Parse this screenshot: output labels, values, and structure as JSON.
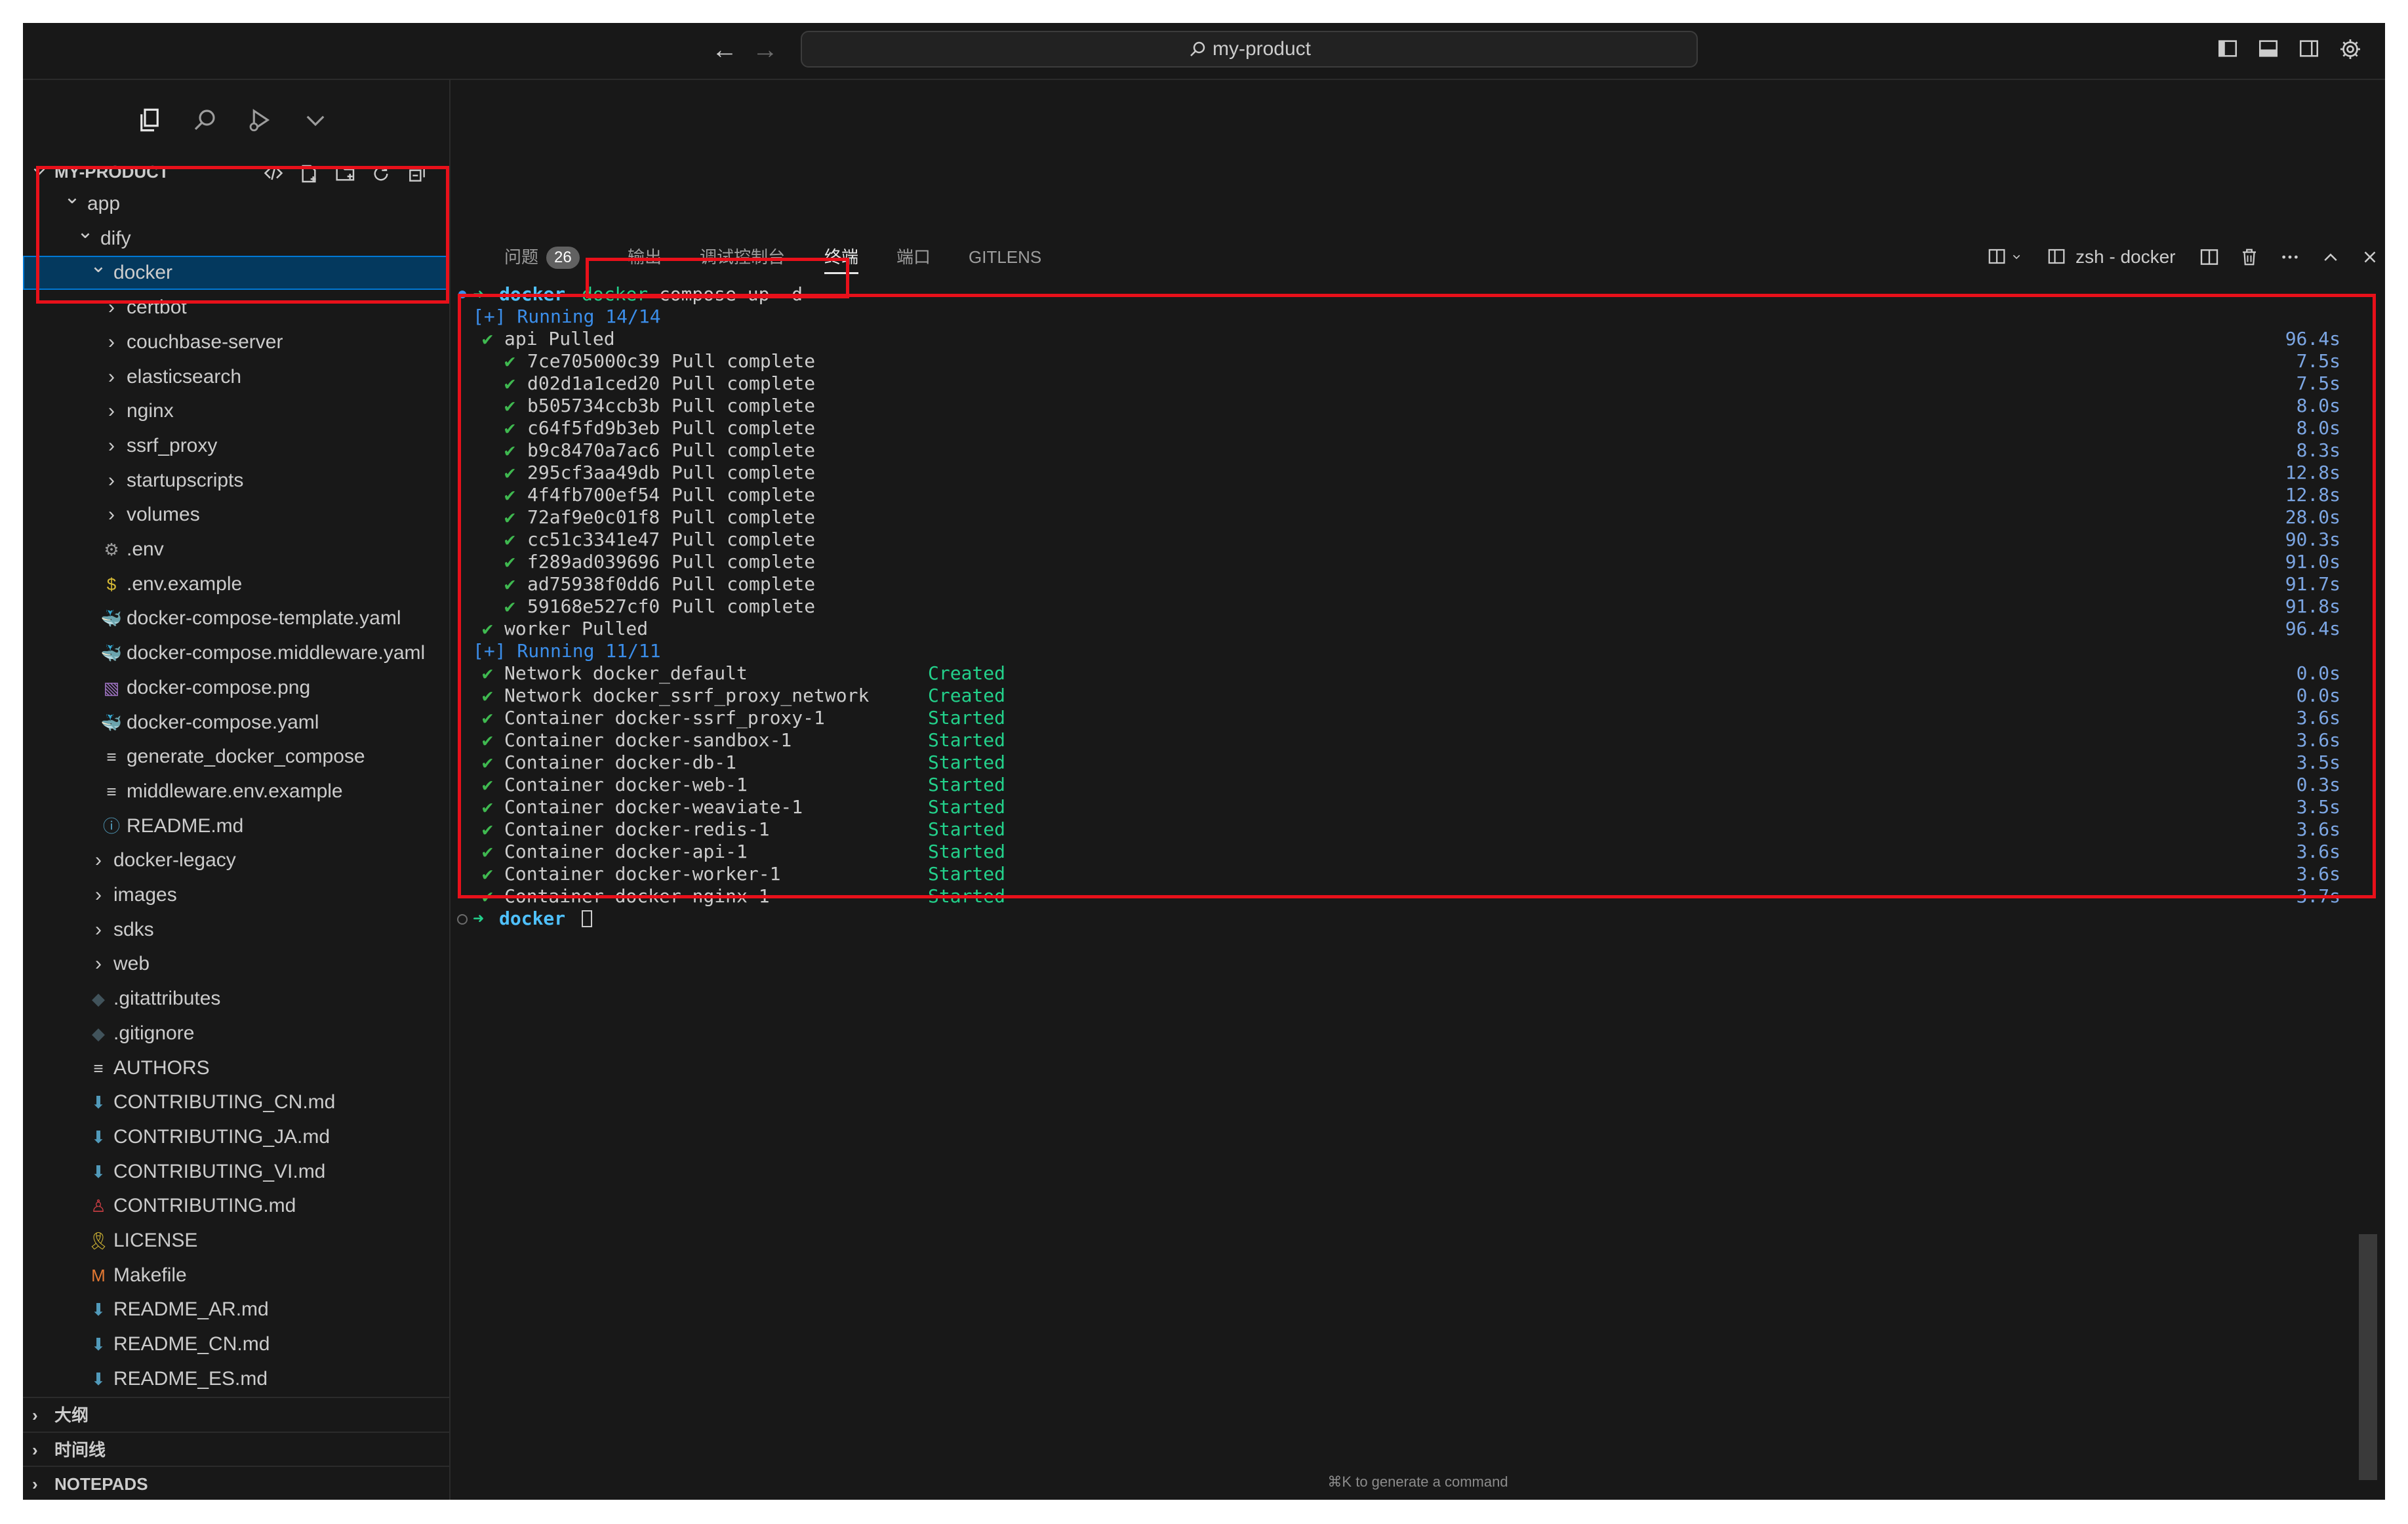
{
  "titlebar": {
    "search_text": "my-product",
    "nav_back": "←",
    "nav_forward": "→"
  },
  "sidebar": {
    "section_title": "MY-PRODUCT",
    "tree": [
      {
        "label": "app",
        "level": 0,
        "type": "folder",
        "open": true
      },
      {
        "label": "dify",
        "level": 1,
        "type": "folder",
        "open": true
      },
      {
        "label": "docker",
        "level": 2,
        "type": "folder",
        "open": true,
        "selected": true
      },
      {
        "label": "certbot",
        "level": 3,
        "type": "folder"
      },
      {
        "label": "couchbase-server",
        "level": 3,
        "type": "folder"
      },
      {
        "label": "elasticsearch",
        "level": 3,
        "type": "folder"
      },
      {
        "label": "nginx",
        "level": 3,
        "type": "folder"
      },
      {
        "label": "ssrf_proxy",
        "level": 3,
        "type": "folder"
      },
      {
        "label": "startupscripts",
        "level": 3,
        "type": "folder"
      },
      {
        "label": "volumes",
        "level": 3,
        "type": "folder"
      },
      {
        "label": ".env",
        "level": 3,
        "type": "gear"
      },
      {
        "label": ".env.example",
        "level": 3,
        "type": "dollar"
      },
      {
        "label": "docker-compose-template.yaml",
        "level": 3,
        "type": "docker"
      },
      {
        "label": "docker-compose.middleware.yaml",
        "level": 3,
        "type": "docker"
      },
      {
        "label": "docker-compose.png",
        "level": 3,
        "type": "image"
      },
      {
        "label": "docker-compose.yaml",
        "level": 3,
        "type": "docker"
      },
      {
        "label": "generate_docker_compose",
        "level": 3,
        "type": "lines"
      },
      {
        "label": "middleware.env.example",
        "level": 3,
        "type": "lines"
      },
      {
        "label": "README.md",
        "level": 3,
        "type": "info"
      },
      {
        "label": "docker-legacy",
        "level": 2,
        "type": "folder"
      },
      {
        "label": "images",
        "level": 2,
        "type": "folder"
      },
      {
        "label": "sdks",
        "level": 2,
        "type": "folder"
      },
      {
        "label": "web",
        "level": 2,
        "type": "folder"
      },
      {
        "label": ".gitattributes",
        "level": 2,
        "type": "git"
      },
      {
        "label": ".gitignore",
        "level": 2,
        "type": "git"
      },
      {
        "label": "AUTHORS",
        "level": 2,
        "type": "lines"
      },
      {
        "label": "CONTRIBUTING_CN.md",
        "level": 2,
        "type": "md"
      },
      {
        "label": "CONTRIBUTING_JA.md",
        "level": 2,
        "type": "md"
      },
      {
        "label": "CONTRIBUTING_VI.md",
        "level": 2,
        "type": "md"
      },
      {
        "label": "CONTRIBUTING.md",
        "level": 2,
        "type": "contrib"
      },
      {
        "label": "LICENSE",
        "level": 2,
        "type": "license"
      },
      {
        "label": "Makefile",
        "level": 2,
        "type": "make"
      },
      {
        "label": "README_AR.md",
        "level": 2,
        "type": "md"
      },
      {
        "label": "README_CN.md",
        "level": 2,
        "type": "md"
      },
      {
        "label": "README_ES.md",
        "level": 2,
        "type": "md"
      }
    ],
    "folded_sections": [
      "大纲",
      "时间线",
      "NOTEPADS"
    ]
  },
  "panel": {
    "tabs": [
      {
        "label": "问题",
        "badge": "26"
      },
      {
        "label": "输出"
      },
      {
        "label": "调试控制台"
      },
      {
        "label": "终端",
        "active": true
      },
      {
        "label": "端口"
      },
      {
        "label": "GITLENS"
      }
    ],
    "terminal_name": "zsh - docker",
    "hint": "⌘K to generate a command"
  },
  "terminal": {
    "prompt_dir": "docker",
    "command_word": "docker",
    "command_rest": " compose up -d",
    "running_pull": "[+] Running 14/14",
    "api_pulled": "api Pulled",
    "api_time": "96.4s",
    "layers": [
      {
        "id": "7ce705000c39",
        "status": "Pull complete",
        "time": "7.5s"
      },
      {
        "id": "d02d1a1ced20",
        "status": "Pull complete",
        "time": "7.5s"
      },
      {
        "id": "b505734ccb3b",
        "status": "Pull complete",
        "time": "8.0s"
      },
      {
        "id": "c64f5fd9b3eb",
        "status": "Pull complete",
        "time": "8.0s"
      },
      {
        "id": "b9c8470a7ac6",
        "status": "Pull complete",
        "time": "8.3s"
      },
      {
        "id": "295cf3aa49db",
        "status": "Pull complete",
        "time": "12.8s"
      },
      {
        "id": "4f4fb700ef54",
        "status": "Pull complete",
        "time": "12.8s"
      },
      {
        "id": "72af9e0c01f8",
        "status": "Pull complete",
        "time": "28.0s"
      },
      {
        "id": "cc51c3341e47",
        "status": "Pull complete",
        "time": "90.3s"
      },
      {
        "id": "f289ad039696",
        "status": "Pull complete",
        "time": "91.0s"
      },
      {
        "id": "ad75938f0dd6",
        "status": "Pull complete",
        "time": "91.7s"
      },
      {
        "id": "59168e527cf0",
        "status": "Pull complete",
        "time": "91.8s"
      }
    ],
    "worker_pulled": "worker Pulled",
    "worker_time": "96.4s",
    "running_start": "[+] Running 11/11",
    "resources": [
      {
        "name": "Network docker_default",
        "status": "Created",
        "time": "0.0s"
      },
      {
        "name": "Network docker_ssrf_proxy_network",
        "status": "Created",
        "time": "0.0s"
      },
      {
        "name": "Container docker-ssrf_proxy-1",
        "status": "Started",
        "time": "3.6s"
      },
      {
        "name": "Container docker-sandbox-1",
        "status": "Started",
        "time": "3.6s"
      },
      {
        "name": "Container docker-db-1",
        "status": "Started",
        "time": "3.5s"
      },
      {
        "name": "Container docker-web-1",
        "status": "Started",
        "time": "0.3s"
      },
      {
        "name": "Container docker-weaviate-1",
        "status": "Started",
        "time": "3.5s"
      },
      {
        "name": "Container docker-redis-1",
        "status": "Started",
        "time": "3.6s"
      },
      {
        "name": "Container docker-api-1",
        "status": "Started",
        "time": "3.6s"
      },
      {
        "name": "Container docker-worker-1",
        "status": "Started",
        "time": "3.6s"
      },
      {
        "name": "Container docker-nginx-1",
        "status": "Started",
        "time": "3.7s"
      }
    ],
    "check_glyph": "✔",
    "prompt_arrow": "➜"
  },
  "colors": {
    "annotation_red": "#e8101a",
    "selection": "#04395e",
    "docker_icon": "#e06c9f",
    "md_icon": "#519aba"
  }
}
